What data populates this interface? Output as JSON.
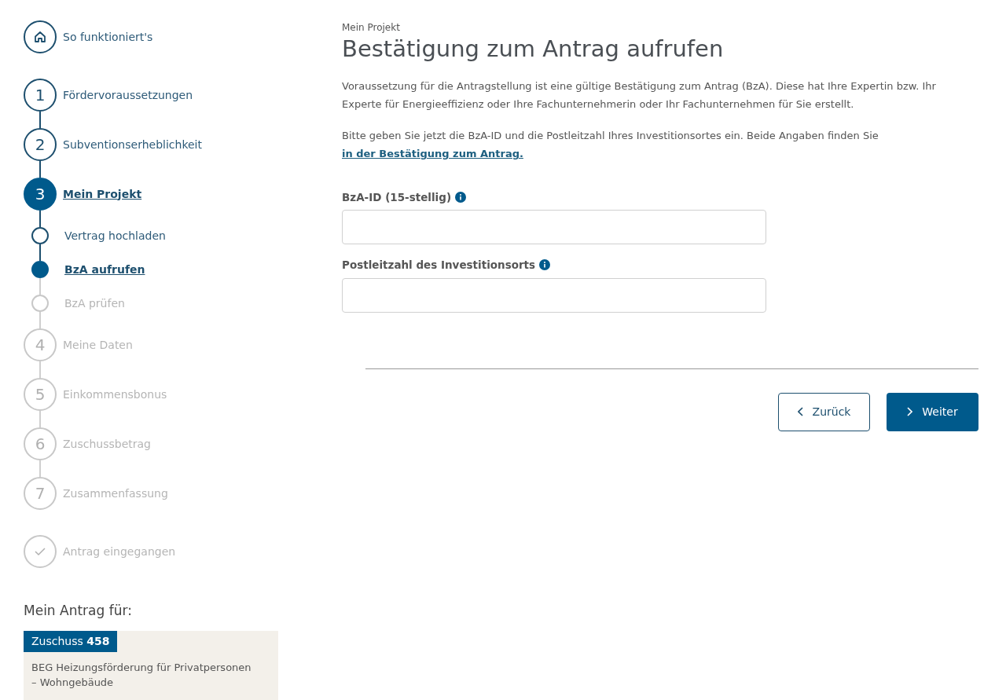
{
  "stepper": [
    {
      "kind": "home",
      "label": "So funktioniert's",
      "done": true,
      "selected": false
    },
    {
      "kind": "number",
      "number": "1",
      "label": "Fördervoraussetzungen",
      "done": true,
      "selected": false
    },
    {
      "kind": "number",
      "number": "2",
      "label": "Subventionserheblichkeit",
      "done": true,
      "selected": false
    },
    {
      "kind": "number",
      "number": "3",
      "label": "Mein Projekt",
      "done": false,
      "selected": true,
      "children": [
        {
          "kind": "sub",
          "label": "Vertrag hochladen",
          "done": true,
          "selected": false
        },
        {
          "kind": "sub",
          "label": "BzA aufrufen",
          "done": false,
          "selected": true
        },
        {
          "kind": "sub",
          "label": "BzA prüfen",
          "done": false,
          "selected": false
        }
      ]
    },
    {
      "kind": "number",
      "number": "4",
      "label": "Meine Daten",
      "done": false,
      "selected": false
    },
    {
      "kind": "number",
      "number": "5",
      "label": "Einkommensbonus",
      "done": false,
      "selected": false
    },
    {
      "kind": "number",
      "number": "6",
      "label": "Zuschussbetrag",
      "done": false,
      "selected": false
    },
    {
      "kind": "number",
      "number": "7",
      "label": "Zusammenfassung",
      "done": false,
      "selected": false
    },
    {
      "kind": "final",
      "label": "Antrag eingegangen",
      "done": false,
      "selected": false
    }
  ],
  "application": {
    "heading": "Mein Antrag für:",
    "badge": "Zuschuss **458**",
    "description": "BEG Heizungsförderung für Privatpersonen – Wohngebäude"
  },
  "main": {
    "eyebrow": "Mein Projekt",
    "title": "Bestätigung zum Antrag aufrufen",
    "intro": "Voraussetzung für die Antragstellung ist eine gültige Bestätigung zum Antrag (BzA). Diese hat Ihre Expertin bzw. Ihr Experte für Energieeffizienz oder Ihre Fachunternehmerin oder Ihr Fachunternehmen für Sie erstellt.",
    "instruction": "Bitte geben Sie jetzt die BzA-ID und die Postleitzahl Ihres Investitionsortes ein. Beide Angaben finden Sie",
    "link": "in der Bestätigung zum Antrag.",
    "fields": [
      {
        "label": "BzA-ID (15-stellig)"
      },
      {
        "label": "Postleitzahl des Investitionsorts"
      }
    ],
    "buttons": [
      {
        "kind": "back",
        "label": "Zurück"
      },
      {
        "kind": "next",
        "label": "Weiter"
      }
    ]
  }
}
